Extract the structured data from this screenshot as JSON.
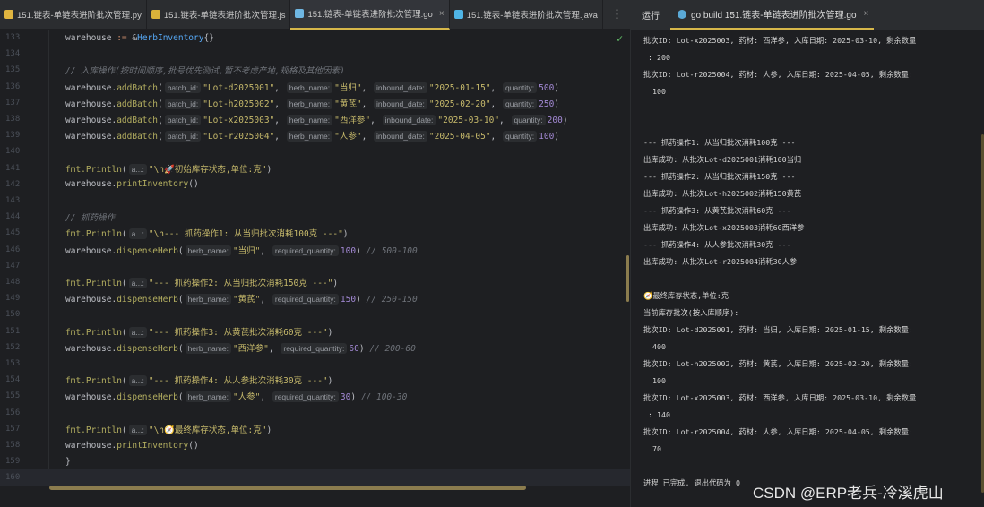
{
  "tabs": [
    {
      "label": "151.链表-单链表进阶批次管理.py",
      "icon": "python-icon",
      "color": "#e0b540",
      "active": false
    },
    {
      "label": "151.链表-单链表进阶批次管理.js",
      "icon": "js-icon",
      "color": "#d9b23a",
      "active": false
    },
    {
      "label": "151.链表-单链表进阶批次管理.go",
      "icon": "go-icon",
      "color": "#6fb7e3",
      "active": true
    },
    {
      "label": "151.链表-单链表进阶批次管理.java",
      "icon": "java-icon",
      "color": "#4fb5e6",
      "active": false
    }
  ],
  "more_label": "⋮",
  "code": [
    {
      "n": "133",
      "t": [
        [
          "id",
          "warehouse "
        ],
        [
          "op",
          ":= "
        ],
        [
          "id",
          "&"
        ],
        [
          "fn",
          "HerbInventory"
        ],
        [
          "id",
          "{}"
        ]
      ]
    },
    {
      "n": "134",
      "t": []
    },
    {
      "n": "135",
      "t": [
        [
          "cm",
          "// 入库操作(按时间顺序,批号优先测试,暂不考虑产地,规格及其他因素)"
        ]
      ]
    },
    {
      "n": "136",
      "t": [
        [
          "id",
          "warehouse."
        ],
        [
          "pk",
          "addBatch"
        ],
        [
          "id",
          "("
        ],
        [
          "hint",
          "batch_id:"
        ],
        [
          "str",
          "\"Lot-d2025001\""
        ],
        [
          "id",
          ", "
        ],
        [
          "hint",
          "herb_name:"
        ],
        [
          "str",
          "\"当归\""
        ],
        [
          "id",
          ", "
        ],
        [
          "hint",
          "inbound_date:"
        ],
        [
          "str",
          "\"2025-01-15\""
        ],
        [
          "id",
          ", "
        ],
        [
          "hint",
          "quantity:"
        ],
        [
          "num",
          "500"
        ],
        [
          "id",
          ")"
        ]
      ]
    },
    {
      "n": "137",
      "t": [
        [
          "id",
          "warehouse."
        ],
        [
          "pk",
          "addBatch"
        ],
        [
          "id",
          "("
        ],
        [
          "hint",
          "batch_id:"
        ],
        [
          "str",
          "\"Lot-h2025002\""
        ],
        [
          "id",
          ", "
        ],
        [
          "hint",
          "herb_name:"
        ],
        [
          "str",
          "\"黄芪\""
        ],
        [
          "id",
          ", "
        ],
        [
          "hint",
          "inbound_date:"
        ],
        [
          "str",
          "\"2025-02-20\""
        ],
        [
          "id",
          ", "
        ],
        [
          "hint",
          "quantity:"
        ],
        [
          "num",
          "250"
        ],
        [
          "id",
          ")"
        ]
      ]
    },
    {
      "n": "138",
      "t": [
        [
          "id",
          "warehouse."
        ],
        [
          "pk",
          "addBatch"
        ],
        [
          "id",
          "("
        ],
        [
          "hint",
          "batch_id:"
        ],
        [
          "str",
          "\"Lot-x2025003\""
        ],
        [
          "id",
          ", "
        ],
        [
          "hint",
          "herb_name:"
        ],
        [
          "str",
          "\"西洋参\""
        ],
        [
          "id",
          ", "
        ],
        [
          "hint",
          "inbound_date:"
        ],
        [
          "str",
          "\"2025-03-10\""
        ],
        [
          "id",
          ", "
        ],
        [
          "hint",
          "quantity:"
        ],
        [
          "num",
          "200"
        ],
        [
          "id",
          ")"
        ]
      ]
    },
    {
      "n": "139",
      "t": [
        [
          "id",
          "warehouse."
        ],
        [
          "pk",
          "addBatch"
        ],
        [
          "id",
          "("
        ],
        [
          "hint",
          "batch_id:"
        ],
        [
          "str",
          "\"Lot-r2025004\""
        ],
        [
          "id",
          ", "
        ],
        [
          "hint",
          "herb_name:"
        ],
        [
          "str",
          "\"人参\""
        ],
        [
          "id",
          ", "
        ],
        [
          "hint",
          "inbound_date:"
        ],
        [
          "str",
          "\"2025-04-05\""
        ],
        [
          "id",
          ", "
        ],
        [
          "hint",
          "quantity:"
        ],
        [
          "num",
          "100"
        ],
        [
          "id",
          ")"
        ]
      ]
    },
    {
      "n": "140",
      "t": []
    },
    {
      "n": "141",
      "t": [
        [
          "pk",
          "fmt.Println"
        ],
        [
          "id",
          "("
        ],
        [
          "hint",
          "a...:"
        ],
        [
          "str",
          "\"\\n🚀初始库存状态,单位:克\""
        ],
        [
          "id",
          ")"
        ]
      ]
    },
    {
      "n": "142",
      "t": [
        [
          "id",
          "warehouse."
        ],
        [
          "pk",
          "printInventory"
        ],
        [
          "id",
          "()"
        ]
      ]
    },
    {
      "n": "143",
      "t": []
    },
    {
      "n": "144",
      "t": [
        [
          "cm",
          "// 抓药操作"
        ]
      ]
    },
    {
      "n": "145",
      "t": [
        [
          "pk",
          "fmt.Println"
        ],
        [
          "id",
          "("
        ],
        [
          "hint",
          "a...:"
        ],
        [
          "str",
          "\"\\n--- 抓药操作1: 从当归批次消耗100克 ---\""
        ],
        [
          "id",
          ")"
        ]
      ]
    },
    {
      "n": "146",
      "t": [
        [
          "id",
          "warehouse."
        ],
        [
          "pk",
          "dispenseHerb"
        ],
        [
          "id",
          "("
        ],
        [
          "hint",
          "herb_name:"
        ],
        [
          "str",
          "\"当归\""
        ],
        [
          "id",
          ", "
        ],
        [
          "hint",
          "required_quantity:"
        ],
        [
          "num",
          "100"
        ],
        [
          "id",
          ") "
        ],
        [
          "cm",
          "// 500-100"
        ]
      ]
    },
    {
      "n": "147",
      "t": []
    },
    {
      "n": "148",
      "t": [
        [
          "pk",
          "fmt.Println"
        ],
        [
          "id",
          "("
        ],
        [
          "hint",
          "a...:"
        ],
        [
          "str",
          "\"--- 抓药操作2: 从当归批次消耗150克 ---\""
        ],
        [
          "id",
          ")"
        ]
      ]
    },
    {
      "n": "149",
      "t": [
        [
          "id",
          "warehouse."
        ],
        [
          "pk",
          "dispenseHerb"
        ],
        [
          "id",
          "("
        ],
        [
          "hint",
          "herb_name:"
        ],
        [
          "str",
          "\"黄芪\""
        ],
        [
          "id",
          ", "
        ],
        [
          "hint",
          "required_quantity:"
        ],
        [
          "num",
          "150"
        ],
        [
          "id",
          ") "
        ],
        [
          "cm",
          "// 250-150"
        ]
      ]
    },
    {
      "n": "150",
      "t": []
    },
    {
      "n": "151",
      "t": [
        [
          "pk",
          "fmt.Println"
        ],
        [
          "id",
          "("
        ],
        [
          "hint",
          "a...:"
        ],
        [
          "str",
          "\"--- 抓药操作3: 从黄芪批次消耗60克 ---\""
        ],
        [
          "id",
          ")"
        ]
      ]
    },
    {
      "n": "152",
      "t": [
        [
          "id",
          "warehouse."
        ],
        [
          "pk",
          "dispenseHerb"
        ],
        [
          "id",
          "("
        ],
        [
          "hint",
          "herb_name:"
        ],
        [
          "str",
          "\"西洋参\""
        ],
        [
          "id",
          ", "
        ],
        [
          "hint",
          "required_quantity:"
        ],
        [
          "num",
          "60"
        ],
        [
          "id",
          ") "
        ],
        [
          "cm",
          "// 200-60"
        ]
      ]
    },
    {
      "n": "153",
      "t": []
    },
    {
      "n": "154",
      "t": [
        [
          "pk",
          "fmt.Println"
        ],
        [
          "id",
          "("
        ],
        [
          "hint",
          "a...:"
        ],
        [
          "str",
          "\"--- 抓药操作4: 从人参批次消耗30克 ---\""
        ],
        [
          "id",
          ")"
        ]
      ]
    },
    {
      "n": "155",
      "t": [
        [
          "id",
          "warehouse."
        ],
        [
          "pk",
          "dispenseHerb"
        ],
        [
          "id",
          "("
        ],
        [
          "hint",
          "herb_name:"
        ],
        [
          "str",
          "\"人参\""
        ],
        [
          "id",
          ", "
        ],
        [
          "hint",
          "required_quantity:"
        ],
        [
          "num",
          "30"
        ],
        [
          "id",
          ") "
        ],
        [
          "cm",
          "// 100-30"
        ]
      ]
    },
    {
      "n": "156",
      "t": []
    },
    {
      "n": "157",
      "t": [
        [
          "pk",
          "fmt.Println"
        ],
        [
          "id",
          "("
        ],
        [
          "hint",
          "a...:"
        ],
        [
          "str",
          "\"\\n🧭最终库存状态,单位:克\""
        ],
        [
          "id",
          ")"
        ]
      ]
    },
    {
      "n": "158",
      "t": [
        [
          "id",
          "warehouse."
        ],
        [
          "pk",
          "printInventory"
        ],
        [
          "id",
          "()"
        ]
      ]
    },
    {
      "n": "159",
      "t": [
        [
          "id",
          "}"
        ]
      ]
    },
    {
      "n": "160",
      "t": [],
      "current": true
    }
  ],
  "run": {
    "label": "运行",
    "tab_label": "go build 151.链表-单链表进阶批次管理.go",
    "close": "×",
    "output": [
      "批次ID: Lot-x2025003, 药材: 西洋参, 入库日期: 2025-03-10, 剩余数量",
      " : 200",
      "批次ID: Lot-r2025004, 药材: 人参, 入库日期: 2025-04-05, 剩余数量:",
      "  100",
      "",
      "",
      "--- 抓药操作1: 从当归批次消耗100克 ---",
      "出库成功: 从批次Lot-d2025001消耗100当归",
      "--- 抓药操作2: 从当归批次消耗150克 ---",
      "出库成功: 从批次Lot-h2025002消耗150黄芪",
      "--- 抓药操作3: 从黄芪批次消耗60克 ---",
      "出库成功: 从批次Lot-x2025003消耗60西洋参",
      "--- 抓药操作4: 从人参批次消耗30克 ---",
      "出库成功: 从批次Lot-r2025004消耗30人参",
      "",
      "🧭最终库存状态,单位:克",
      "当前库存批次(按入库顺序):",
      "批次ID: Lot-d2025001, 药材: 当归, 入库日期: 2025-01-15, 剩余数量:",
      "  400",
      "批次ID: Lot-h2025002, 药材: 黄芪, 入库日期: 2025-02-20, 剩余数量:",
      "  100",
      "批次ID: Lot-x2025003, 药材: 西洋参, 入库日期: 2025-03-10, 剩余数量",
      " : 140",
      "批次ID: Lot-r2025004, 药材: 人参, 入库日期: 2025-04-05, 剩余数量:",
      "  70",
      "",
      "进程 已完成, 退出代码为 0"
    ]
  },
  "watermark": "CSDN @ERP老兵-冷溪虎山"
}
